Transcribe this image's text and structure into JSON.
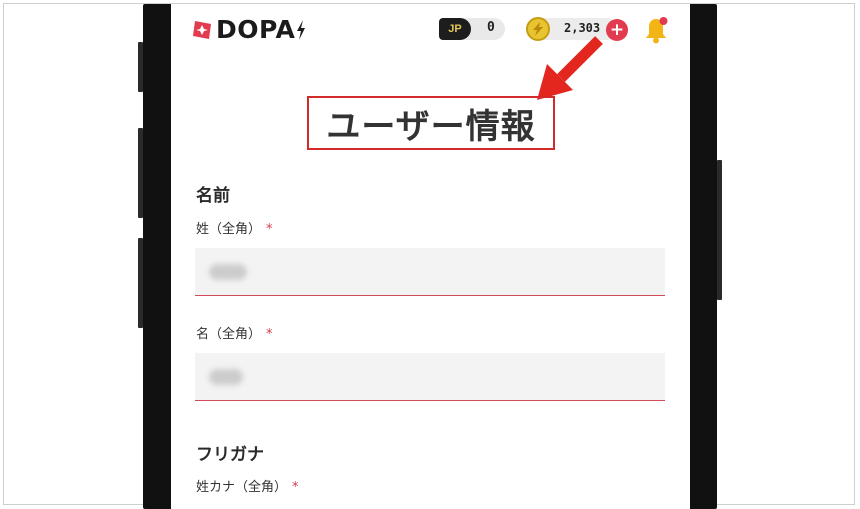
{
  "header": {
    "logo_text": "DOPA",
    "jp_label": "JP",
    "jp_count": "0",
    "coin_count": "2,303",
    "plus_label": "+"
  },
  "page": {
    "title": "ユーザー情報"
  },
  "form": {
    "name_section": "名前",
    "last_name_label": "姓（全角）",
    "first_name_label": "名（全角）",
    "required_mark": "*",
    "kana_section": "フリガナ",
    "last_name_kana_label": "姓カナ（全角）"
  },
  "colors": {
    "accent": "#d32a2a",
    "brand_red": "#e23b4f",
    "coin_gold": "#e9c431"
  }
}
